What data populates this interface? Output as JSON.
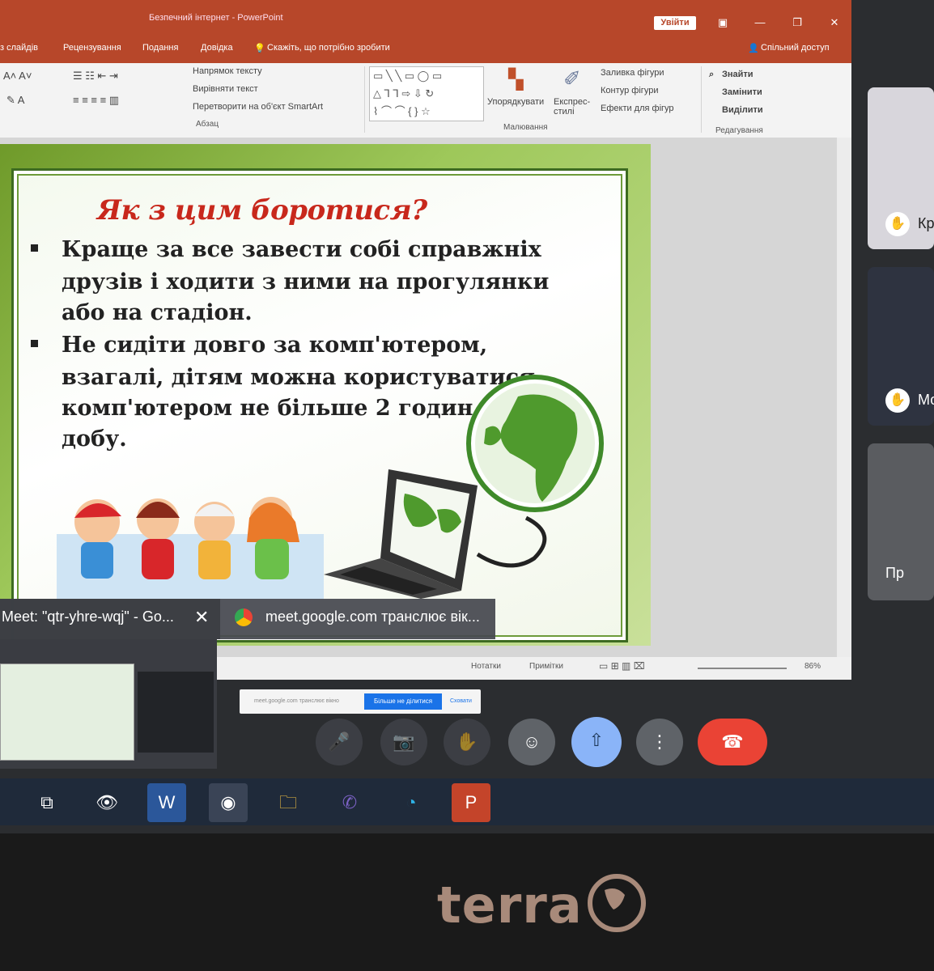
{
  "ppt": {
    "title": "Безпечний інтернет - PowerPoint",
    "signin_label": "Увійти",
    "share_label": "Спільний доступ",
    "menu": [
      "з слайдів",
      "Рецензування",
      "Подання",
      "Довідка"
    ],
    "tell_me": "Скажіть, що потрібно зробити",
    "ribbon": {
      "text_direction": "Напрямок тексту",
      "align_text": "Вирівняти текст",
      "smartart": "Перетворити на об'єкт SmartArt",
      "paragraph_group": "Абзац",
      "arrange": "Упорядкувати",
      "quick_styles": "Експрес-стилі",
      "shape_fill": "Заливка фігури",
      "shape_outline": "Контур фігури",
      "shape_effects": "Ефекти для фігур",
      "drawing_group": "Малювання",
      "find": "Знайти",
      "replace": "Замінити",
      "select": "Виділити",
      "editing_group": "Редагування"
    },
    "status": {
      "notes": "Нотатки",
      "comments": "Примітки",
      "zoom": "86%"
    }
  },
  "slide": {
    "title": "Як з цим боротися?",
    "bullets": [
      [
        "Краще за все завести собі справжніх",
        "друзів і ходити з ними на прогулянки",
        "або на стадіон."
      ],
      [
        "Не сидіти довго за комп'ютером,",
        "взагалі, дітям можна користуватися",
        "комп'ютером не більше 2 годин на",
        "добу."
      ]
    ]
  },
  "meet": {
    "tab_title": "Meet: \"qtr-yhre-wqj\" - Go...",
    "sharing_title": "meet.google.com транслює вік...",
    "notice_text": "meet.google.com транслює вікно",
    "stop_label": "Більше не ділитися",
    "hide_label": "Сховати"
  },
  "participants": [
    {
      "name": "Кр"
    },
    {
      "name": "Мо"
    },
    {
      "name": "Пр"
    }
  ],
  "taskbar": [
    "task-view",
    "app-eye",
    "word",
    "chrome",
    "file-explorer",
    "viber",
    "edge",
    "powerpoint"
  ],
  "brand": "terra",
  "colors": {
    "ppt_accent": "#b7472a",
    "title_red": "#c8281c",
    "end_call": "#ea4335",
    "present": "#8ab4f8"
  }
}
